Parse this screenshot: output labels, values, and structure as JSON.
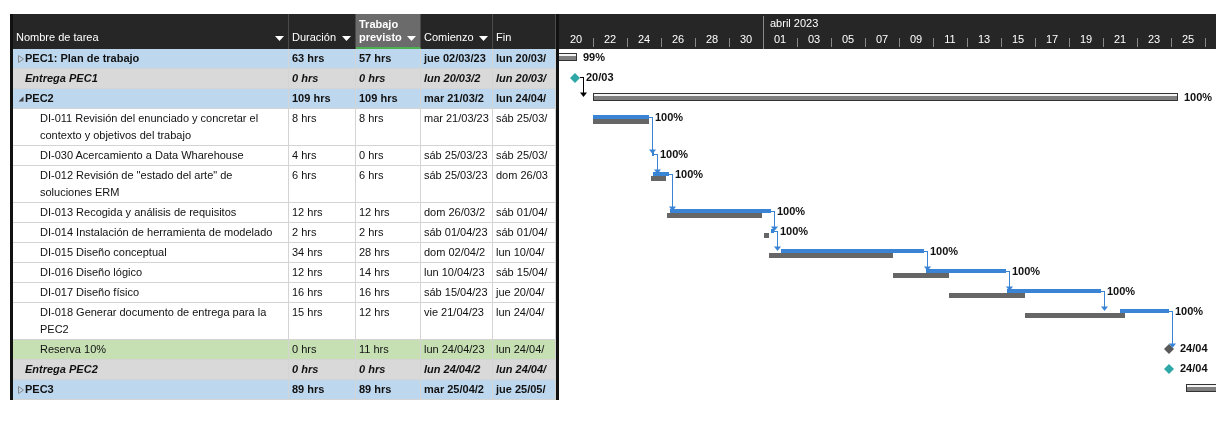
{
  "table": {
    "columns": [
      {
        "label": "Nombre de tarea",
        "menu": true,
        "selected": false
      },
      {
        "label": "Duración",
        "menu": true,
        "selected": false
      },
      {
        "label": "Trabajo previsto",
        "menu": true,
        "selected": true
      },
      {
        "label": "Comienzo",
        "menu": true,
        "selected": false
      },
      {
        "label": "Fin",
        "menu": false,
        "selected": false
      }
    ],
    "rows": [
      {
        "kind": "summary",
        "expanded": false,
        "name": "PEC1: Plan de trabajo",
        "duration": "63 hrs",
        "work": "57 hrs",
        "start": "jue 02/03/23",
        "finish": "lun 20/03/",
        "gantt": {
          "kind": "summary",
          "label": "99%",
          "linked": false
        }
      },
      {
        "kind": "milestone",
        "name": "Entrega PEC1",
        "duration": "0 hrs",
        "work": "0 hrs",
        "start": "lun 20/03/2",
        "finish": "lun 20/03/",
        "gantt": {
          "kind": "milestone",
          "label": "20/03",
          "color": "#2fa7a7",
          "linked": true
        }
      },
      {
        "kind": "summary",
        "expanded": true,
        "name": "PEC2",
        "duration": "109 hrs",
        "work": "109 hrs",
        "start": "mar 21/03/2",
        "finish": "lun 24/04/",
        "gantt": {
          "kind": "summary",
          "label": "100%",
          "linked": false
        },
        "children": [
          {
            "kind": "task",
            "name": "DI-011 Revisión del enunciado y concretar el contexto y objetivos del trabajo",
            "duration": "8 hrs",
            "work": "8 hrs",
            "start": "mar 21/03/23",
            "finish": "sáb 25/03/",
            "gantt": {
              "kind": "task",
              "label": "100%",
              "linked": true
            }
          },
          {
            "kind": "task",
            "name": "DI-030 Acercamiento a Data Wharehouse",
            "duration": "4 hrs",
            "work": "0 hrs",
            "start": "sáb 25/03/23",
            "finish": "sáb 25/03/",
            "gantt": {
              "kind": "task",
              "label": "100%",
              "linked": true
            }
          },
          {
            "kind": "task",
            "name": "DI-012 Revisión de \"estado del arte\" de soluciones ERM",
            "duration": "6 hrs",
            "work": "6 hrs",
            "start": "sáb 25/03/23",
            "finish": "dom 26/03",
            "gantt": {
              "kind": "task",
              "label": "100%",
              "linked": true
            }
          },
          {
            "kind": "task",
            "name": "DI-013 Recogida y análisis de requisitos",
            "duration": "12 hrs",
            "work": "12 hrs",
            "start": "dom 26/03/2",
            "finish": "sáb 01/04/",
            "gantt": {
              "kind": "task",
              "label": "100%",
              "linked": true
            }
          },
          {
            "kind": "task",
            "name": "DI-014 Instalación de herramienta de modelado",
            "duration": "2 hrs",
            "work": "2 hrs",
            "start": "sáb 01/04/23",
            "finish": "sáb 01/04/",
            "gantt": {
              "kind": "task",
              "label": "100%",
              "linked": true
            }
          },
          {
            "kind": "task",
            "name": "DI-015 Diseño conceptual",
            "duration": "34 hrs",
            "work": "28 hrs",
            "start": "dom 02/04/2",
            "finish": "lun 10/04/",
            "gantt": {
              "kind": "task",
              "label": "100%",
              "linked": true
            }
          },
          {
            "kind": "task",
            "name": "DI-016 Diseño lógico",
            "duration": "12 hrs",
            "work": "14 hrs",
            "start": "lun 10/04/23",
            "finish": "sáb 15/04/",
            "gantt": {
              "kind": "task",
              "label": "100%",
              "linked": true
            }
          },
          {
            "kind": "task",
            "name": "DI-017 Diseño físico",
            "duration": "16 hrs",
            "work": "16 hrs",
            "start": "sáb 15/04/23",
            "finish": "jue 20/04/",
            "gantt": {
              "kind": "task",
              "label": "100%",
              "linked": true
            }
          },
          {
            "kind": "task",
            "name": "DI-018 Generar documento de entrega para la PEC2",
            "duration": "15 hrs",
            "work": "12 hrs",
            "start": "vie 21/04/23",
            "finish": "lun 24/04/",
            "gantt": {
              "kind": "task",
              "label": "100%",
              "linked": true
            }
          },
          {
            "kind": "reserve",
            "name": "Reserva 10%",
            "duration": "0 hrs",
            "work": "11 hrs",
            "start": "lun 24/04/23",
            "finish": "lun 24/04/",
            "gantt": {
              "kind": "milestone",
              "label": "24/04",
              "color": "#595959",
              "linked": false
            }
          }
        ]
      },
      {
        "kind": "milestone",
        "name": "Entrega PEC2",
        "duration": "0 hrs",
        "work": "0 hrs",
        "start": "lun 24/04/2",
        "finish": "lun 24/04/",
        "gantt": {
          "kind": "milestone",
          "label": "24/04",
          "color": "#2fa7a7",
          "linked": false
        }
      },
      {
        "kind": "summary",
        "expanded": false,
        "name": "PEC3",
        "duration": "89 hrs",
        "work": "89 hrs",
        "start": "mar 25/04/2",
        "finish": "jue 25/05/",
        "gantt": {
          "kind": "summary"
        }
      }
    ]
  },
  "timeline": {
    "days": [
      {
        "label": "20"
      },
      {
        "label": "22"
      },
      {
        "label": "24"
      },
      {
        "label": "26"
      },
      {
        "label": "28"
      },
      {
        "label": "30"
      },
      {
        "label": "01",
        "month": "abril 2023"
      },
      {
        "label": "03"
      },
      {
        "label": "05"
      },
      {
        "label": "07"
      },
      {
        "label": "09"
      },
      {
        "label": "11"
      },
      {
        "label": "13"
      },
      {
        "label": "15"
      },
      {
        "label": "17"
      },
      {
        "label": "19"
      },
      {
        "label": "21"
      },
      {
        "label": "23"
      },
      {
        "label": "25"
      }
    ]
  }
}
